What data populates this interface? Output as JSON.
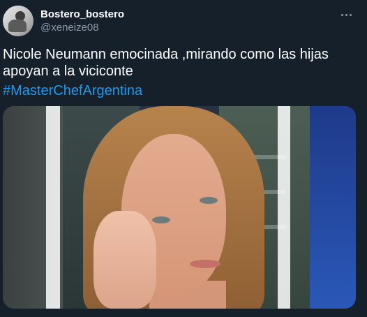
{
  "author": {
    "display_name": "Bostero_bostero",
    "handle": "@xeneize08"
  },
  "tweet": {
    "text": "Nicole Neumann emocinada ,mirando como las hijas apoyan a la viciconte",
    "hashtag": "#MasterChefArgentina"
  },
  "icons": {
    "avatar": "profile-avatar",
    "more": "more-horizontal-icon"
  },
  "colors": {
    "background": "#15202b",
    "link": "#1d9bf0",
    "secondary_text": "#8b98a5"
  }
}
